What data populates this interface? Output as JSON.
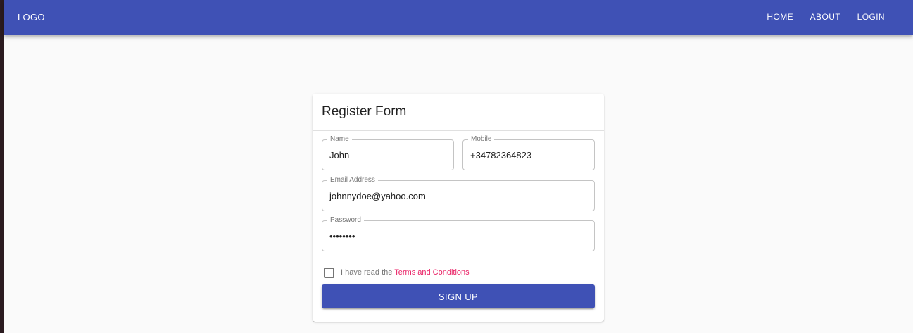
{
  "appbar": {
    "logo": "LOGO",
    "nav": {
      "home": "HOME",
      "about": "ABOUT",
      "login": "LOGIN"
    }
  },
  "form": {
    "title": "Register Form",
    "fields": {
      "name": {
        "label": "Name",
        "value": "John"
      },
      "mobile": {
        "label": "Mobile",
        "value": "+34782364823"
      },
      "email": {
        "label": "Email Address",
        "value": "johnnydoe@yahoo.com"
      },
      "password": {
        "label": "Password",
        "value": "••••••••"
      }
    },
    "terms": {
      "prefix": "I have read the ",
      "link": "Terms and Conditions",
      "checked": false
    },
    "submit_label": "SIGN UP"
  },
  "colors": {
    "primary": "#3f51b5",
    "accent": "#e91e63",
    "background": "#fafafa"
  }
}
